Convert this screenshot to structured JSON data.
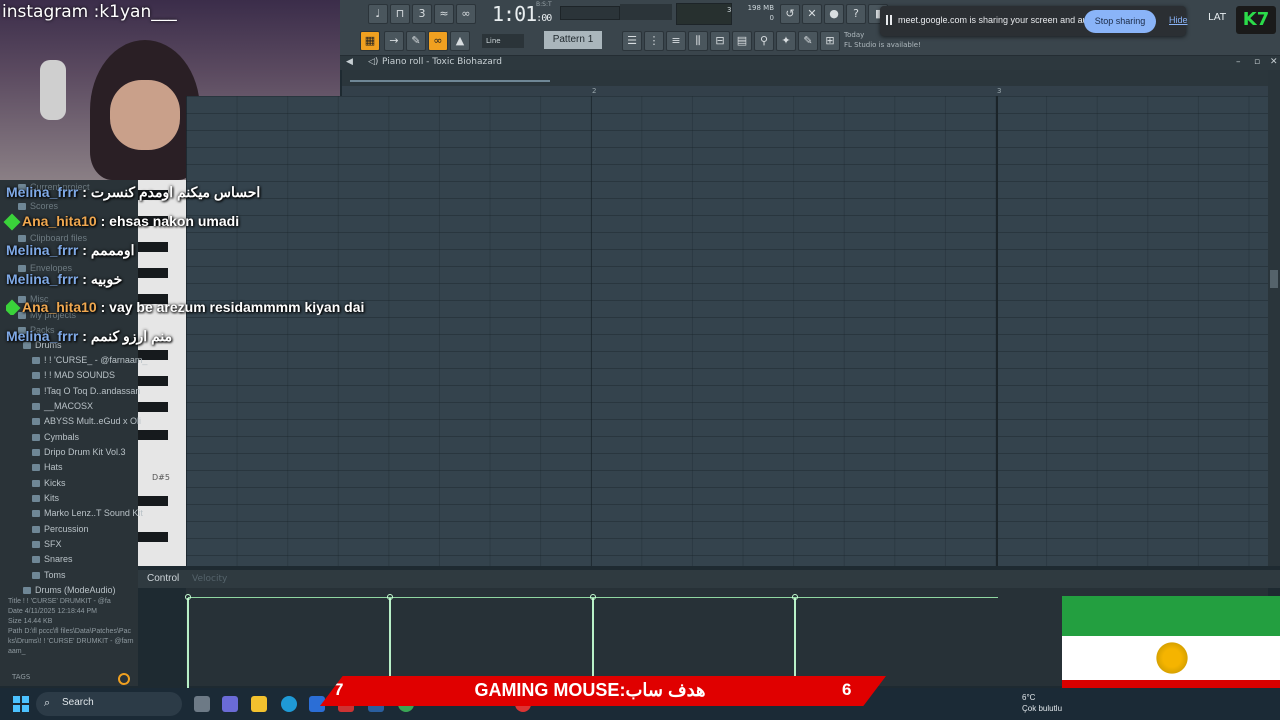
{
  "overlay": {
    "instagram": "instagram :k1yan___",
    "chat": [
      {
        "user": "Melina_frrr",
        "message": "احساس میکنم اومدم کنسرت"
      },
      {
        "user": "Ana_hita10",
        "message": "ehsas nakon umadi"
      },
      {
        "user": "Melina_frrr",
        "message": "اومممم"
      },
      {
        "user": "Melina_frrr",
        "message": "خوبیه"
      },
      {
        "user": "Ana_hita10",
        "message": "vay be arezum residammmm kiyan dai"
      },
      {
        "user": "Melina_frrr",
        "message": "منم ارزو کنمم"
      }
    ],
    "goal_left": "7",
    "goal_title": "GAMING MOUSE:هدف ساب",
    "goal_right": "6",
    "logo": "K7",
    "flag_emblem": "lion-and-sun"
  },
  "fl_studio": {
    "time": "1:01",
    "time_small": ":00",
    "cpu_value": "3",
    "ram": "198 MB",
    "ram_sub": "0",
    "mode": "Line",
    "pattern": "Pattern 1",
    "hint_title": "Today",
    "hint_text": "FL Studio is available!",
    "bst": "B:S:T"
  },
  "meet": {
    "text": "meet.google.com is sharing your screen and audio.",
    "stop_label": "Stop sharing",
    "hide_label": "Hide",
    "lat": "LAT"
  },
  "piano_roll": {
    "title": "Piano roll - Toxic Biohazard",
    "bar_2": "2",
    "bar_3": "3",
    "key_label": "D#5",
    "control_label": "Control",
    "control_param": "Velocity"
  },
  "browser": {
    "faded": [
      "Current project",
      "Scores",
      "Clipboard files",
      "Envelopes",
      "Misc",
      "My projects",
      "Packs"
    ],
    "items": [
      "Drums",
      "! ! 'CURSE_ - @farnaam_",
      "! ! MAD SOUNDS",
      "!Taq O Toq D..andassan",
      "__MACOSX",
      "ABYSS Mult..eGud x Oli",
      "Cymbals",
      "Dripo Drum Kit Vol.3",
      "Hats",
      "Kicks",
      "Kits",
      "Marko Lenz..T Sound Kit",
      "Percussion",
      "SFX",
      "Snares",
      "Toms",
      "Drums (ModeAudio)"
    ],
    "info": {
      "title_label": "Title",
      "title": "! ! 'CURSE' DRUMKIT - @fa",
      "date_label": "Date",
      "date": "4/11/2025 12:18:44 PM",
      "size_label": "Size",
      "size": "14.44 KB",
      "path_label": "Path",
      "path": "D:\\fl pccc\\fl files\\Data\\Patches\\Packs\\Drums\\! ! 'CURSE' DRUMKIT - @farnaam_"
    },
    "tags": "TAGS"
  },
  "taskbar": {
    "search": "Search",
    "temp": "6°C",
    "weather": "Çok bulutlu"
  }
}
